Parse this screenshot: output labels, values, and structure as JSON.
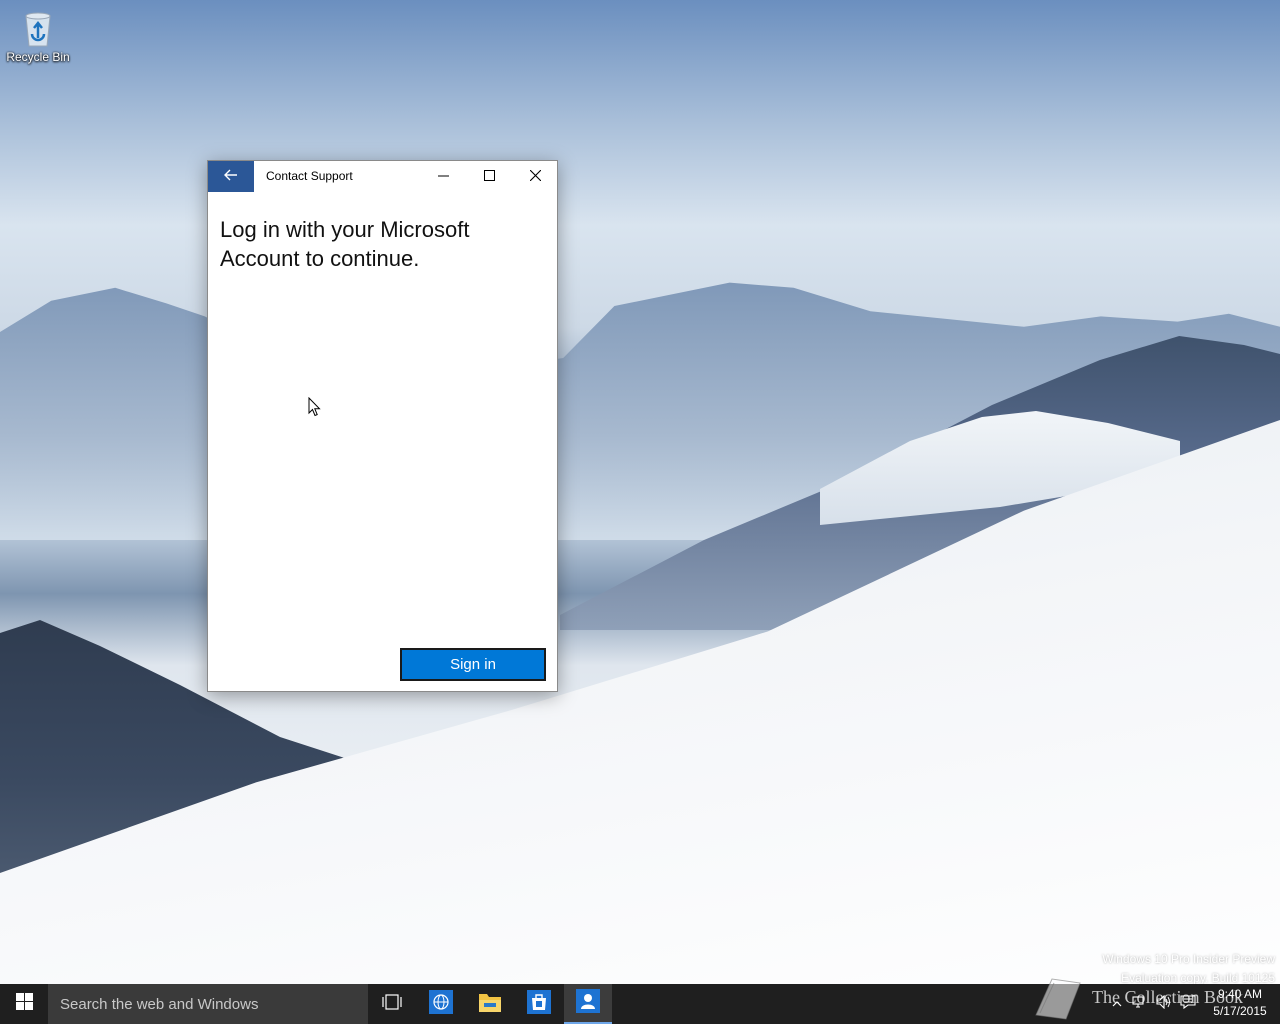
{
  "desktop": {
    "icons": [
      {
        "label": "Recycle Bin",
        "icon": "recycle-bin-icon"
      }
    ],
    "watermark": {
      "line1": "Windows 10 Pro Insider Preview",
      "line2": "Evaluation copy. Build 10125"
    },
    "overlay_logo_text": "The Collection Book"
  },
  "window": {
    "title": "Contact Support",
    "back_icon": "back-arrow-icon",
    "controls": [
      "minimize-icon",
      "maximize-icon",
      "close-icon"
    ],
    "heading": "Log in with your Microsoft Account to continue.",
    "primary_button": "Sign in",
    "accent_color": "#2b5797",
    "button_color": "#0078d7"
  },
  "taskbar": {
    "search_placeholder": "Search the web and Windows",
    "pinned": [
      {
        "name": "task-view",
        "icon": "task-view-icon"
      },
      {
        "name": "browser",
        "icon": "globe-icon"
      },
      {
        "name": "file-explorer",
        "icon": "folder-icon"
      },
      {
        "name": "store",
        "icon": "store-bag-icon"
      },
      {
        "name": "contact-support",
        "icon": "person-icon",
        "active": true
      }
    ],
    "clock": {
      "time": "9:40 AM",
      "date": "5/17/2015"
    },
    "tray_icons": [
      "chevron-up-icon",
      "network-icon",
      "volume-icon",
      "action-center-icon"
    ]
  }
}
